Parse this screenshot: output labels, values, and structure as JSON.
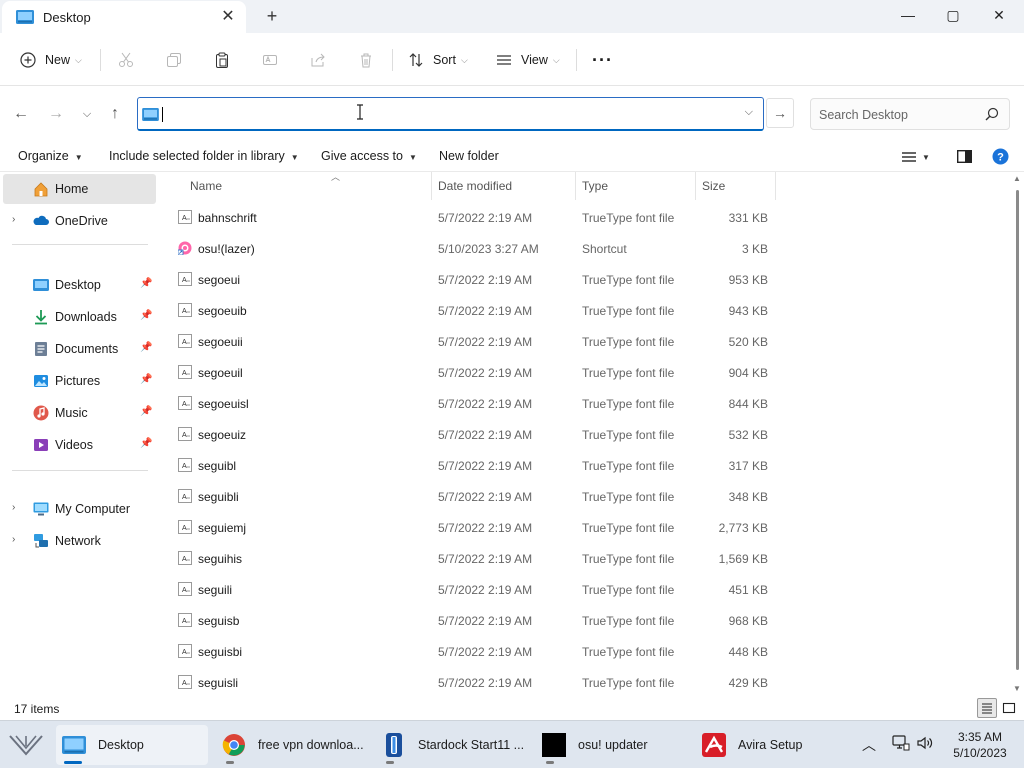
{
  "window": {
    "tab_title": "Desktop",
    "new_tab": "+",
    "close_tab": "✕",
    "controls": {
      "minimize": "—",
      "maximize": "▢",
      "close": "✕"
    }
  },
  "command_bar": {
    "new_label": "New",
    "sort_label": "Sort",
    "view_label": "View",
    "more_label": "···"
  },
  "address_bar": {
    "value": "",
    "search_placeholder": "Search Desktop"
  },
  "toolbar": {
    "organize": "Organize",
    "include_library": "Include selected folder in library",
    "give_access": "Give access to",
    "new_folder": "New folder"
  },
  "sidebar": {
    "home": "Home",
    "onedrive": "OneDrive",
    "quick_access": [
      {
        "label": "Desktop",
        "icon": "desktop-icon"
      },
      {
        "label": "Downloads",
        "icon": "downloads-icon"
      },
      {
        "label": "Documents",
        "icon": "documents-icon"
      },
      {
        "label": "Pictures",
        "icon": "pictures-icon"
      },
      {
        "label": "Music",
        "icon": "music-icon"
      },
      {
        "label": "Videos",
        "icon": "videos-icon"
      }
    ],
    "my_computer": "My Computer",
    "network": "Network"
  },
  "columns": {
    "name": "Name",
    "date": "Date modified",
    "type": "Type",
    "size": "Size"
  },
  "files": [
    {
      "name": "bahnschrift",
      "date": "5/7/2022 2:19 AM",
      "type": "TrueType font file",
      "size": "331 KB",
      "icon": "font"
    },
    {
      "name": "osu!(lazer)",
      "date": "5/10/2023 3:27 AM",
      "type": "Shortcut",
      "size": "3 KB",
      "icon": "osu"
    },
    {
      "name": "segoeui",
      "date": "5/7/2022 2:19 AM",
      "type": "TrueType font file",
      "size": "953 KB",
      "icon": "font"
    },
    {
      "name": "segoeuib",
      "date": "5/7/2022 2:19 AM",
      "type": "TrueType font file",
      "size": "943 KB",
      "icon": "font"
    },
    {
      "name": "segoeuii",
      "date": "5/7/2022 2:19 AM",
      "type": "TrueType font file",
      "size": "520 KB",
      "icon": "font"
    },
    {
      "name": "segoeuil",
      "date": "5/7/2022 2:19 AM",
      "type": "TrueType font file",
      "size": "904 KB",
      "icon": "font"
    },
    {
      "name": "segoeuisl",
      "date": "5/7/2022 2:19 AM",
      "type": "TrueType font file",
      "size": "844 KB",
      "icon": "font"
    },
    {
      "name": "segoeuiz",
      "date": "5/7/2022 2:19 AM",
      "type": "TrueType font file",
      "size": "532 KB",
      "icon": "font"
    },
    {
      "name": "seguibl",
      "date": "5/7/2022 2:19 AM",
      "type": "TrueType font file",
      "size": "317 KB",
      "icon": "font"
    },
    {
      "name": "seguibli",
      "date": "5/7/2022 2:19 AM",
      "type": "TrueType font file",
      "size": "348 KB",
      "icon": "font"
    },
    {
      "name": "seguiemj",
      "date": "5/7/2022 2:19 AM",
      "type": "TrueType font file",
      "size": "2,773 KB",
      "icon": "font"
    },
    {
      "name": "seguihis",
      "date": "5/7/2022 2:19 AM",
      "type": "TrueType font file",
      "size": "1,569 KB",
      "icon": "font"
    },
    {
      "name": "seguili",
      "date": "5/7/2022 2:19 AM",
      "type": "TrueType font file",
      "size": "451 KB",
      "icon": "font"
    },
    {
      "name": "seguisb",
      "date": "5/7/2022 2:19 AM",
      "type": "TrueType font file",
      "size": "968 KB",
      "icon": "font"
    },
    {
      "name": "seguisbi",
      "date": "5/7/2022 2:19 AM",
      "type": "TrueType font file",
      "size": "448 KB",
      "icon": "font"
    },
    {
      "name": "seguisli",
      "date": "5/7/2022 2:19 AM",
      "type": "TrueType font file",
      "size": "429 KB",
      "icon": "font"
    }
  ],
  "status": {
    "item_count": "17 items"
  },
  "taskbar": {
    "items": [
      {
        "label": "Desktop",
        "icon": "file-explorer-icon"
      },
      {
        "label": "free vpn downloa...",
        "icon": "chrome-icon"
      },
      {
        "label": "Stardock Start11 ...",
        "icon": "stardock-icon"
      },
      {
        "label": "osu! updater",
        "icon": "osu-updater-icon"
      },
      {
        "label": "Avira Setup",
        "icon": "avira-icon"
      }
    ],
    "clock_time": "3:35 AM",
    "clock_date": "5/10/2023"
  },
  "colors": {
    "accent": "#0067c0",
    "folder_blue": "#2f8fd8",
    "avira_red": "#d81e28",
    "osu_pink": "#ff66aa"
  }
}
